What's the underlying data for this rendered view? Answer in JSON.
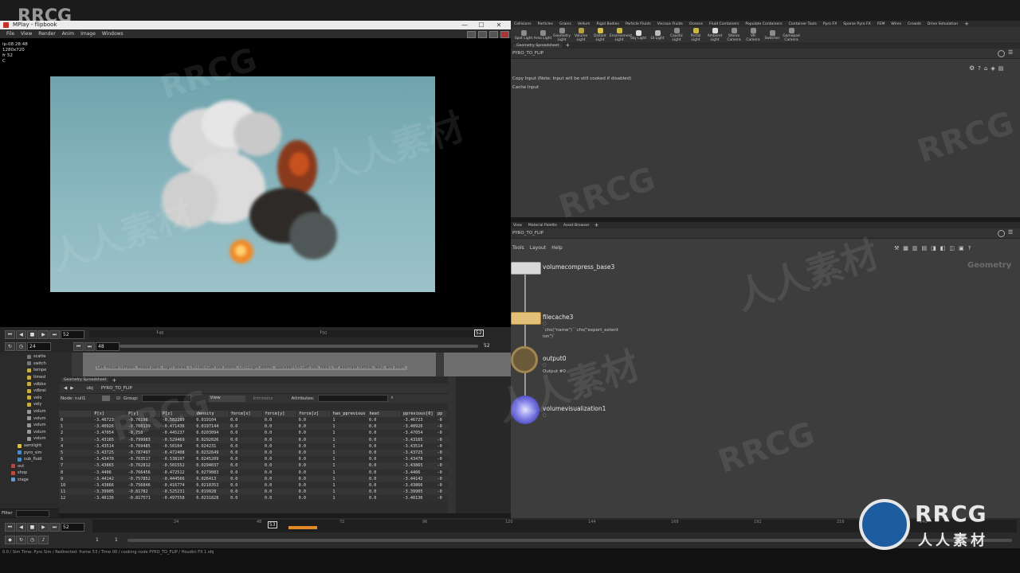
{
  "mplay": {
    "title": "MPlay - flipbook",
    "menu": [
      "File",
      "View",
      "Render",
      "Anim",
      "Image",
      "Windows"
    ],
    "info_lines": [
      "ip-08:28:48",
      "1280x720",
      "fr 52",
      "C"
    ],
    "playback_buttons": [
      "⏮",
      "◀",
      "■",
      "▶",
      "⏭"
    ],
    "current_frame": "52",
    "range_start": "24",
    "range_mid": "48",
    "range_end": "52",
    "end_marker": "52",
    "ruler_labels": [
      "48",
      "50",
      "52"
    ]
  },
  "shelf": {
    "tabs": [
      "Collisions",
      "Particles",
      "Grains",
      "Vellum",
      "Rigid Bodies",
      "Particle Fluids",
      "Viscous Fluids",
      "Oceans",
      "Fluid Containers",
      "Populate Containers",
      "Container Tools",
      "Pyro FX",
      "Sparse Pyro FX",
      "FEM",
      "Wires",
      "Crowds",
      "Drive Simulation"
    ],
    "tools": [
      "Spot Light",
      "Area Light",
      "Geometry Light",
      "Volume Light",
      "Distant Light",
      "Environment Light",
      "Sky Light",
      "GI Light",
      "Caustic Light",
      "Portal Light",
      "Ambient Light",
      "Stereo Camera",
      "VR Camera",
      "Switcher",
      "Gamepad Camera"
    ]
  },
  "param_pane": {
    "tab": "Geometry Spreadsheet",
    "path": "PYRO_TO_FLIP",
    "copy_input_label": "Copy Input (Note: Input will be still cooked if disabled)",
    "cache_input_label": "Cache Input"
  },
  "network_pane": {
    "tabs": [
      "View",
      "Material Palette",
      "Asset Browser"
    ],
    "path": "PYRO_TO_FLIP",
    "menu": [
      "Tools",
      "Layout",
      "Help"
    ],
    "context_label": "Geometry",
    "nodes": [
      {
        "name": "volumecompress_base3",
        "sub": []
      },
      {
        "name": "filecache3",
        "sub": [
          "`chs(\"name\")``chs(\"export_extent",
          "ion\")`"
        ]
      },
      {
        "name": "output0",
        "sub": [
          "Output #0"
        ]
      },
      {
        "name": "volumevisualization1",
        "sub": []
      }
    ]
  },
  "tree": {
    "items": [
      "scatte",
      "switch",
      "tempe",
      "timesl",
      "vdbbo",
      "vdbrei",
      "velo",
      "vely",
      "volum",
      "volum",
      "volum",
      "volum",
      "volum",
      "aerolight",
      "pyro_sim",
      "sub_fluid",
      "out",
      "shop",
      "stage"
    ],
    "filter_label": "Filter"
  },
  "viewport_hint": "Left mouse tumbles. Middle pans. Right dollies. Ctrl+Alt+Left box zooms. Ctrl+Right zooms. Spacebar-Ctrl-Left tilts. Hold L for alternate tumble, dolly, and zoom.",
  "spreadsheet": {
    "tab": "Geometry Spreadsheet",
    "path_obj": "obj",
    "path_node": "PYRO_TO_FLIP",
    "node_label": "Node: null1",
    "group_label": "Group:",
    "view_label": "View",
    "intrinsic_label": "Intrinsics",
    "attributes_label": "Attributes:",
    "columns": [
      "",
      "P[x]",
      "P[y]",
      "P[z]",
      "density",
      "force[x]",
      "force[y]",
      "force[z]",
      "has_pprevious",
      "heat",
      "pprevious[0]",
      "pp"
    ],
    "rows": [
      [
        "0",
        "-3.46723",
        "-0.76196",
        "-0.582289",
        "0.019104",
        "0.0",
        "0.0",
        "0.0",
        "1",
        "0.0",
        "-3.46723",
        "-0"
      ],
      [
        "1",
        "-3.40926",
        "-0.760139",
        "-0.471436",
        "0.0197144",
        "0.0",
        "0.0",
        "0.0",
        "1",
        "0.0",
        "-3.40926",
        "-0"
      ],
      [
        "2",
        "-3.47054",
        "-0.758",
        "-0.445237",
        "0.0203094",
        "0.0",
        "0.0",
        "0.0",
        "1",
        "0.0",
        "-3.47054",
        "-0"
      ],
      [
        "3",
        "-3.43165",
        "-0.799983",
        "-0.529469",
        "0.0292026",
        "0.0",
        "0.0",
        "0.0",
        "1",
        "0.0",
        "-3.43165",
        "-0"
      ],
      [
        "4",
        "-3.43514",
        "-0.769485",
        "-0.50104",
        "0.024231",
        "0.0",
        "0.0",
        "0.0",
        "1",
        "0.0",
        "-3.43514",
        "-0"
      ],
      [
        "5",
        "-3.43725",
        "-0.787497",
        "-0.472408",
        "0.0232649",
        "0.0",
        "0.0",
        "0.0",
        "1",
        "0.0",
        "-3.43725",
        "-0"
      ],
      [
        "6",
        "-3.43478",
        "-0.763517",
        "-0.538197",
        "0.0245209",
        "0.0",
        "0.0",
        "0.0",
        "1",
        "0.0",
        "-3.43478",
        "-0"
      ],
      [
        "7",
        "-3.43865",
        "-0.762812",
        "-0.501552",
        "0.0294037",
        "0.0",
        "0.0",
        "0.0",
        "1",
        "0.0",
        "-3.43865",
        "-0"
      ],
      [
        "8",
        "-3.4406",
        "-0.766456",
        "-0.472512",
        "0.0279083",
        "0.0",
        "0.0",
        "0.0",
        "1",
        "0.0",
        "-3.4406",
        "-0"
      ],
      [
        "9",
        "-3.44142",
        "-0.757852",
        "-0.444566",
        "0.026413",
        "0.0",
        "0.0",
        "0.0",
        "1",
        "0.0",
        "-3.44142",
        "-0"
      ],
      [
        "10",
        "-3.43866",
        "-0.756846",
        "-0.416774",
        "0.0218353",
        "0.0",
        "0.0",
        "0.0",
        "1",
        "0.0",
        "-3.43866",
        "-0"
      ],
      [
        "11",
        "-3.39905",
        "-0.81782",
        "-0.525231",
        "0.019928",
        "0.0",
        "0.0",
        "0.0",
        "1",
        "0.0",
        "-3.39905",
        "-0"
      ],
      [
        "12",
        "-3.40136",
        "-0.817571",
        "-0.497558",
        "0.0231828",
        "0.0",
        "0.0",
        "0.0",
        "1",
        "0.0",
        "-3.40136",
        "-0"
      ]
    ]
  },
  "global_timeline": {
    "current_frame": "52",
    "marker": "53",
    "range_start": "1",
    "range_start2": "1",
    "ruler_labels": [
      "24",
      "48",
      "72",
      "96",
      "120",
      "144",
      "168",
      "192",
      "216",
      "240"
    ],
    "cache_color": "#e08a2a"
  },
  "status_text": "0.0 / Sim Time: Pyro Sim / Redirected: frame 53 / Time 00 / cooking node PYRO_TO_FLIP / Houdini FX 1 obj",
  "watermark": "RRCG",
  "watermark_cn": "人人素材",
  "logo": {
    "text": "RRCG",
    "sub": "人人素材"
  }
}
